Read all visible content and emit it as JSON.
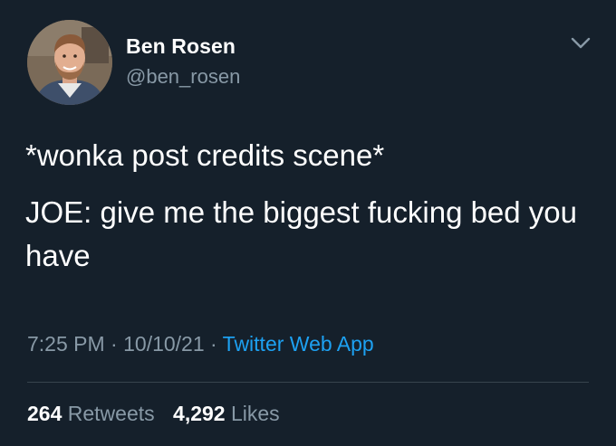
{
  "author": {
    "name": "Ben Rosen",
    "handle": "@ben_rosen"
  },
  "tweet": {
    "paragraphs": [
      "*wonka post credits scene*",
      "JOE: give me the biggest fucking bed you have"
    ]
  },
  "meta": {
    "time": "7:25 PM",
    "separator1": " · ",
    "date": "10/10/21",
    "separator2": " · ",
    "source": "Twitter Web App"
  },
  "stats": {
    "retweets_count": "264",
    "retweets_label": "Retweets",
    "likes_count": "4,292",
    "likes_label": "Likes"
  },
  "icons": {
    "menu": "chevron-down-icon"
  },
  "colors": {
    "background": "#15202b",
    "text": "#ffffff",
    "muted": "#8899a6",
    "link": "#1da1f2",
    "divider": "#38444d"
  }
}
